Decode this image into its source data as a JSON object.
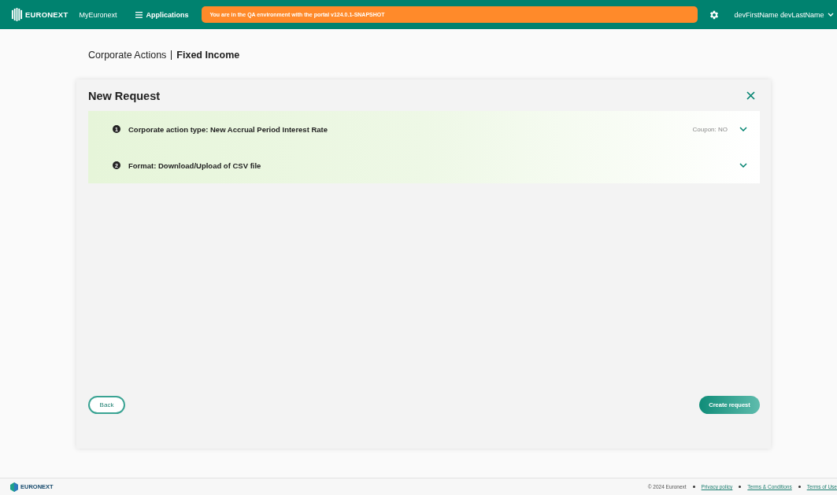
{
  "header": {
    "brand": "EURONEXT",
    "portal": "MyEuronext",
    "menu": "Applications",
    "environment_banner": "You are in the QA environment with the portal v124.0.1-SNAPSHOT",
    "user": "devFirstName devLastName"
  },
  "breadcrumb": {
    "section": "Corporate Actions",
    "page": "Fixed Income"
  },
  "dialog": {
    "title": "New Request",
    "steps": [
      {
        "number": "1",
        "label": "Corporate action type: New Accrual Period Interest Rate",
        "summary": "Coupon: NO",
        "expanded": false
      },
      {
        "number": "2",
        "label": "Format: Download/Upload of CSV file",
        "expanded": false
      }
    ],
    "buttons": {
      "back": "Back",
      "create": "Create request"
    }
  },
  "footer": {
    "brand": "EURONEXT",
    "copyright": "© 2024 Euronext",
    "links": [
      "Privacy policy",
      "Terms & Conditions",
      "Terms of Use"
    ]
  }
}
